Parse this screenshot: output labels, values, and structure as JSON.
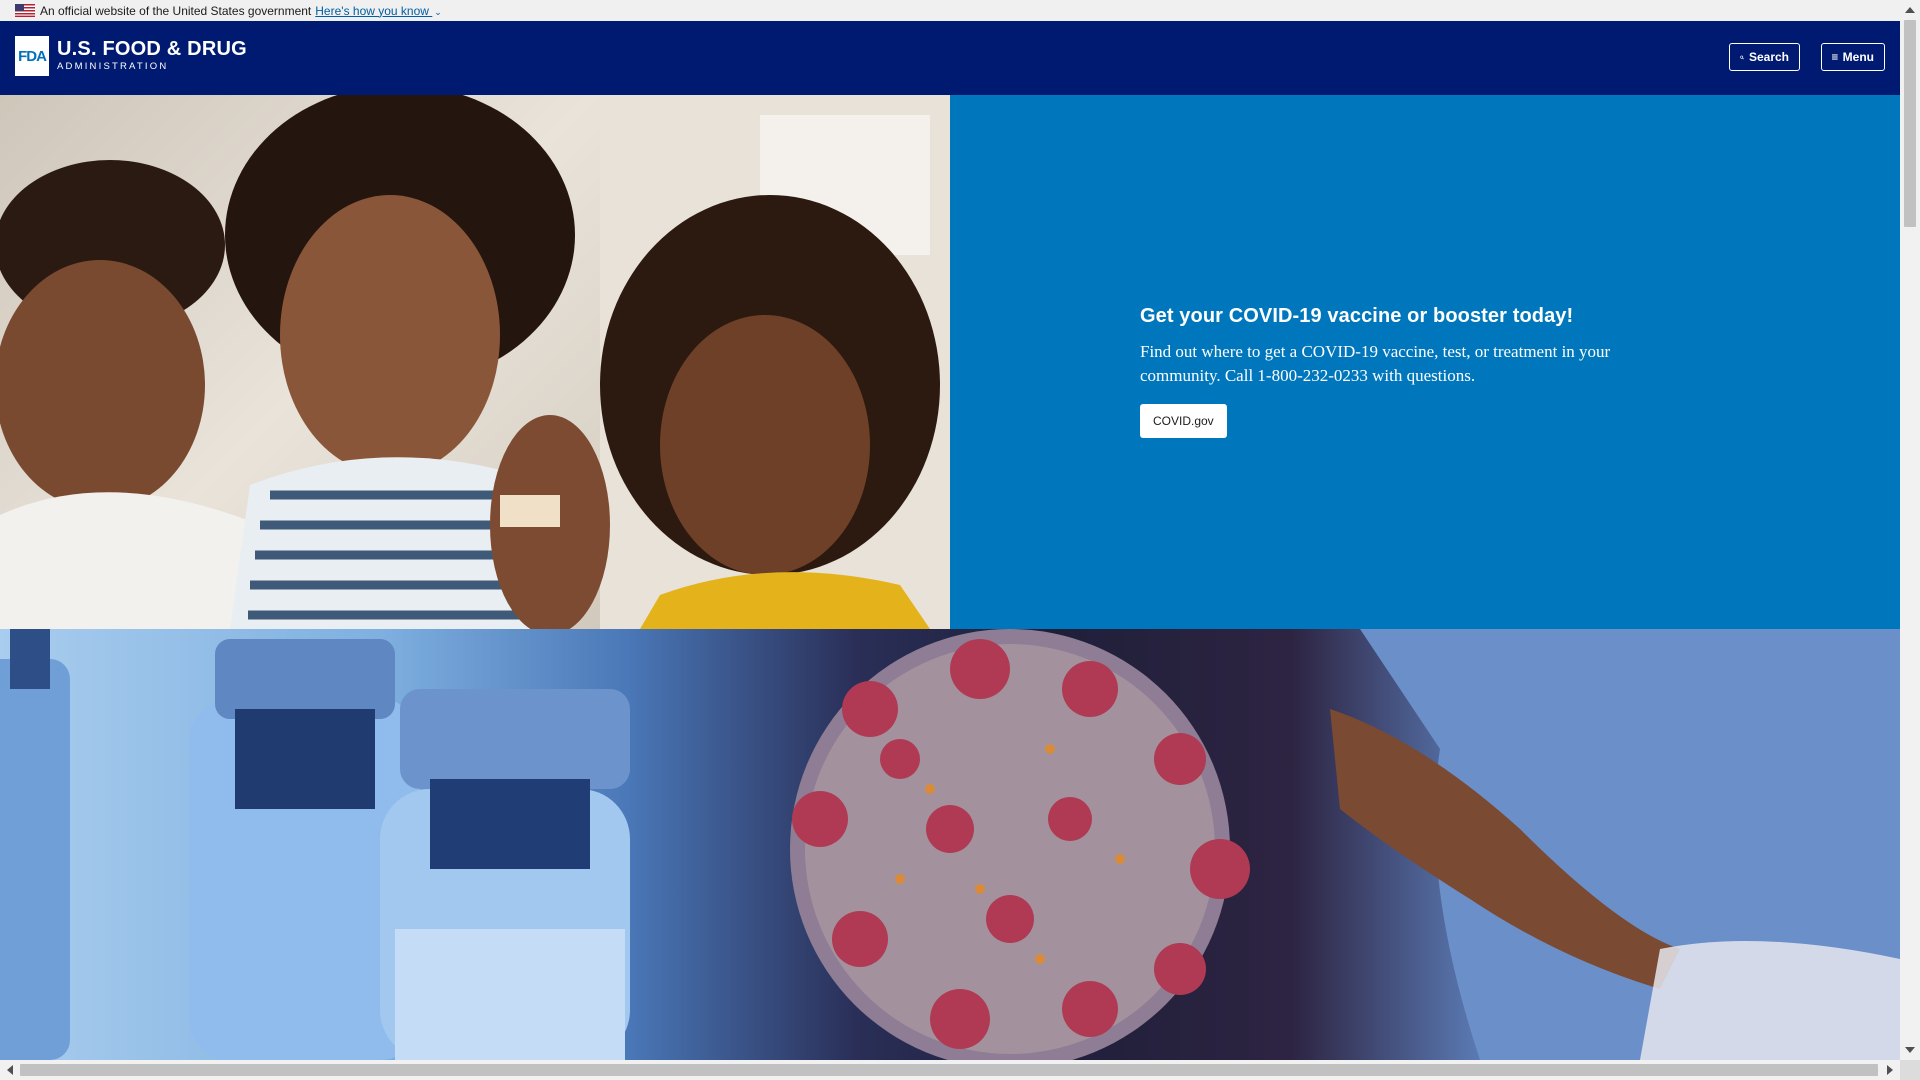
{
  "gov_banner": {
    "text": "An official website of the United States government",
    "link": "Here's how you know",
    "flag_icon": "us-flag-icon",
    "chevron_icon": "chevron-down-icon"
  },
  "header": {
    "logo_mark": "FDA",
    "logo_line1": "U.S. FOOD & DRUG",
    "logo_line2": "ADMINISTRATION",
    "search_label": "Search",
    "menu_label": "Menu",
    "search_icon": "search-icon",
    "menu_icon": "hamburger-menu-icon",
    "bg_color": "#001a72"
  },
  "hero": {
    "title": "Get your COVID-19 vaccine or booster today!",
    "text": "Find out where to get a COVID-19 vaccine, test, or treatment in your community. Call 1-800-232-0233 with questions.",
    "button_label": "COVID.gov",
    "panel_color": "#0077bd"
  }
}
